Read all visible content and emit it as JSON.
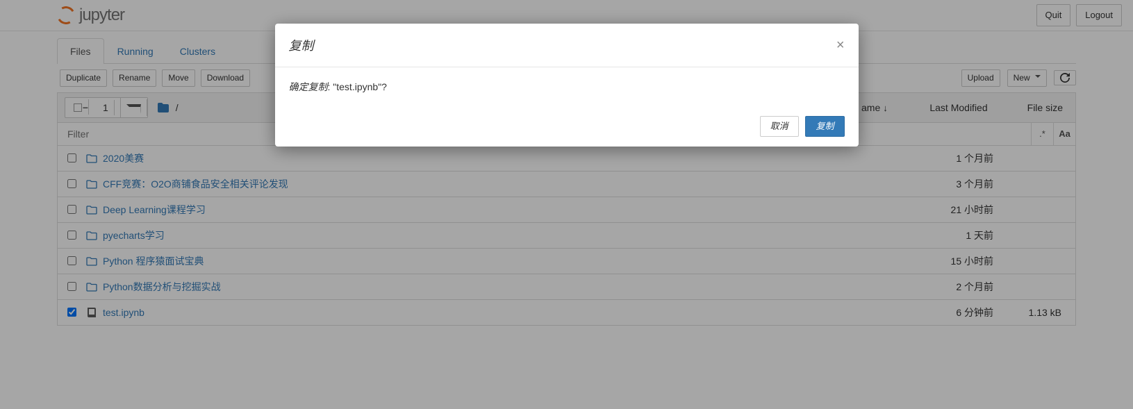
{
  "header": {
    "logo_text": "jupyter",
    "quit": "Quit",
    "logout": "Logout"
  },
  "tabs": {
    "files": "Files",
    "running": "Running",
    "clusters": "Clusters"
  },
  "toolbar": {
    "duplicate": "Duplicate",
    "rename": "Rename",
    "move": "Move",
    "download": "Download",
    "upload": "Upload",
    "new": "New",
    "selected_count": "1",
    "crumb_root": "/"
  },
  "list_header": {
    "name_col": "ame",
    "last_modified": "Last Modified",
    "file_size": "File size"
  },
  "filter": {
    "placeholder": "Filter",
    "regex_label": ".*",
    "case_label": "Aa"
  },
  "rows": [
    {
      "type": "dir",
      "checked": false,
      "name": "2020美赛",
      "time": "1 个月前",
      "size": ""
    },
    {
      "type": "dir",
      "checked": false,
      "name": "CFF竞赛：O2O商铺食品安全相关评论发现",
      "time": "3 个月前",
      "size": ""
    },
    {
      "type": "dir",
      "checked": false,
      "name": "Deep Learning课程学习",
      "time": "21 小时前",
      "size": ""
    },
    {
      "type": "dir",
      "checked": false,
      "name": "pyecharts学习",
      "time": "1 天前",
      "size": ""
    },
    {
      "type": "dir",
      "checked": false,
      "name": "Python 程序猿面试宝典",
      "time": "15 小时前",
      "size": ""
    },
    {
      "type": "dir",
      "checked": false,
      "name": "Python数据分析与挖掘实战",
      "time": "2 个月前",
      "size": ""
    },
    {
      "type": "file",
      "checked": true,
      "name": "test.ipynb",
      "time": "6 分钟前",
      "size": "1.13 kB"
    }
  ],
  "modal": {
    "title": "复制",
    "body_prefix": "确定复制",
    "body_sep": ": \"",
    "body_target": "test.ipynb",
    "body_suffix": "\"?",
    "cancel": "取消",
    "confirm": "复制"
  }
}
